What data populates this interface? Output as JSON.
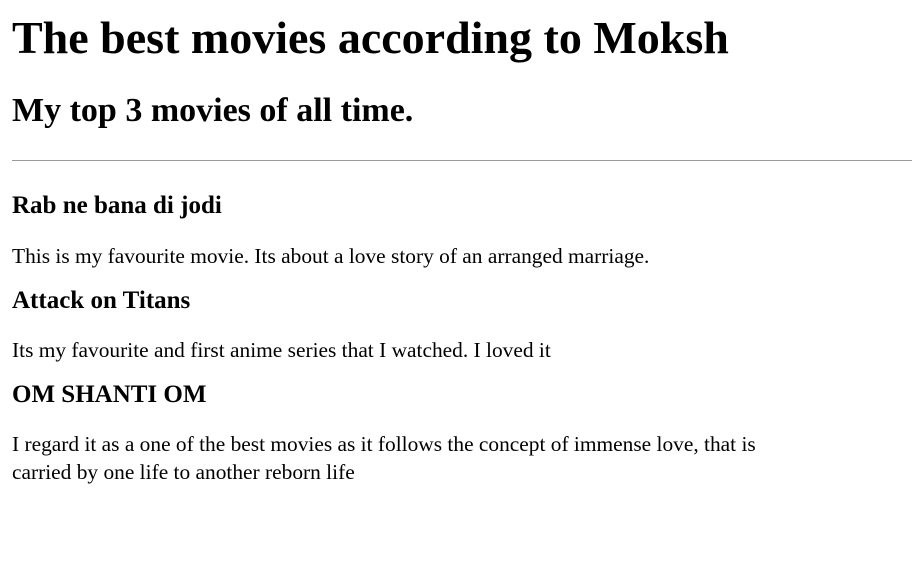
{
  "page": {
    "title": "The best movies according to Moksh",
    "subtitle": "My top 3 movies of all time."
  },
  "movies": [
    {
      "title": "Rab ne bana di jodi",
      "description": "This is my favourite movie. Its about a love story of an arranged marriage."
    },
    {
      "title": "Attack on Titans",
      "description": "Its my favourite and first anime series that I watched. I loved it"
    },
    {
      "title": "OM SHANTI OM",
      "description": "I regard it as a one of the best movies as it follows the concept of immense love, that is carried by one life to another reborn life"
    }
  ]
}
